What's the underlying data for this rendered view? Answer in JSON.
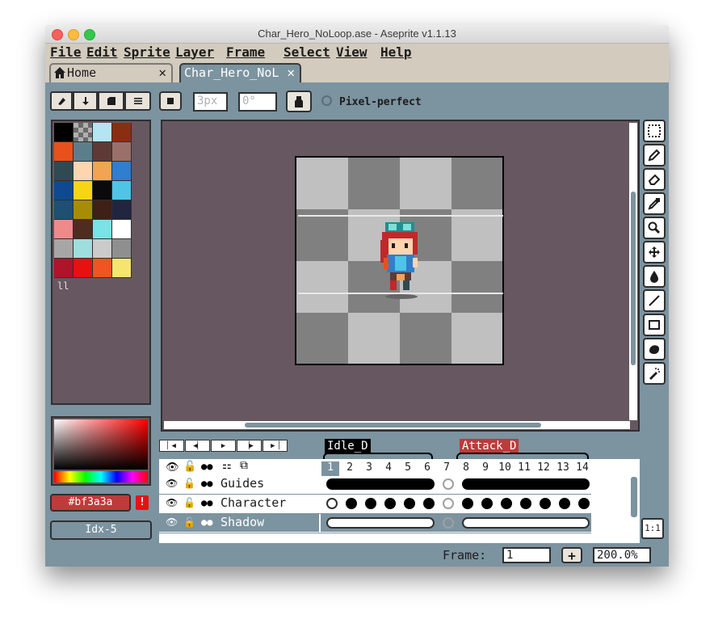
{
  "window": {
    "title": "Char_Hero_NoLoop.ase - Aseprite v1.1.13"
  },
  "menu": [
    "File",
    "Edit",
    "Sprite",
    "Layer",
    "Frame",
    "Select",
    "View",
    "Help"
  ],
  "tabs": {
    "home_label": "Home",
    "active_label": "Char_Hero_NoL",
    "close_glyph": "✕"
  },
  "context_bar": {
    "brush_size": "3px",
    "brush_angle": "0°",
    "pixel_perfect_label": "Pixel-perfect"
  },
  "palette": {
    "colors": [
      "#000000",
      "#7f7f7f",
      "#b3e5f3",
      "#8a2e12",
      "#e8501c",
      "#5b7f8a",
      "#5e3a36",
      "#9b706a",
      "#2f4a50",
      "#fcd5b1",
      "#f3a451",
      "#2f7ecf",
      "#0f4a90",
      "#f6d514",
      "#0a0a0a",
      "#4fc4e7",
      "#1f4f73",
      "#a88c05",
      "#3f2016",
      "#212540",
      "#ee8a8a",
      "#4f2c20",
      "#79e3e5",
      "#ffffff",
      "#a6a6a6",
      "#9fdede",
      "#cbcbcb",
      "#8f8f8f",
      "#b0132a",
      "#e81111",
      "#ee5522",
      "#f6e470"
    ],
    "pages_icon": "ll"
  },
  "color": {
    "hex": "#bf3a3a",
    "index": "Idx-5",
    "warning_glyph": "!"
  },
  "animation": {
    "tags": [
      {
        "name": "Idle_D",
        "color": "#000000"
      },
      {
        "name": "Attack_D",
        "color": "#bf3a3a"
      }
    ],
    "frames": [
      "1",
      "2",
      "3",
      "4",
      "5",
      "6",
      "7",
      "8",
      "9",
      "10",
      "11",
      "12",
      "13",
      "14"
    ],
    "current_frame": "1",
    "layers": [
      {
        "name": "Guides",
        "cels": [
          "l",
          "m",
          "m",
          "m",
          "m",
          "r",
          "e",
          "l",
          "m",
          "m",
          "m",
          "m",
          "m",
          "r"
        ]
      },
      {
        "name": "Character",
        "cels": [
          "w",
          "f",
          "f",
          "f",
          "f",
          "f",
          "e",
          "f",
          "f",
          "f",
          "f",
          "f",
          "f",
          "f"
        ]
      },
      {
        "name": "Shadow",
        "cels": [
          "wl",
          "wm",
          "wm",
          "wm",
          "wm",
          "wr",
          "el",
          "wl",
          "wm",
          "wm",
          "wm",
          "wm",
          "wm",
          "wr"
        ]
      }
    ],
    "selected_layer": "Shadow"
  },
  "status": {
    "frame_label": "Frame:",
    "frame_value": "1",
    "add_glyph": "+",
    "zoom": "200.0%"
  },
  "zoom_button": "1:1"
}
